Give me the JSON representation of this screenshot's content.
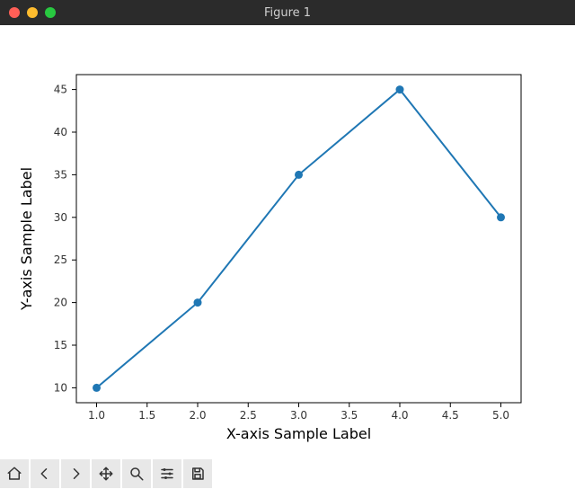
{
  "window": {
    "title": "Figure 1"
  },
  "chart_data": {
    "type": "line",
    "x": [
      1,
      2,
      3,
      4,
      5
    ],
    "y": [
      10,
      20,
      35,
      45,
      30
    ],
    "xlabel": "X-axis Sample Label",
    "ylabel": "Y-axis Sample Label",
    "xlim": [
      0.8,
      5.2
    ],
    "ylim": [
      8.25,
      46.75
    ],
    "xticks": [
      1.0,
      1.5,
      2.0,
      2.5,
      3.0,
      3.5,
      4.0,
      4.5,
      5.0
    ],
    "yticks": [
      10,
      15,
      20,
      25,
      30,
      35,
      40,
      45
    ],
    "xtick_labels": [
      "1.0",
      "1.5",
      "2.0",
      "2.5",
      "3.0",
      "3.5",
      "4.0",
      "4.5",
      "5.0"
    ],
    "ytick_labels": [
      "10",
      "15",
      "20",
      "25",
      "30",
      "35",
      "40",
      "45"
    ]
  },
  "toolbar": {
    "home": "Home",
    "back": "Back",
    "forward": "Forward",
    "pan": "Pan",
    "zoom": "Zoom",
    "configure": "Configure subplots",
    "save": "Save"
  }
}
